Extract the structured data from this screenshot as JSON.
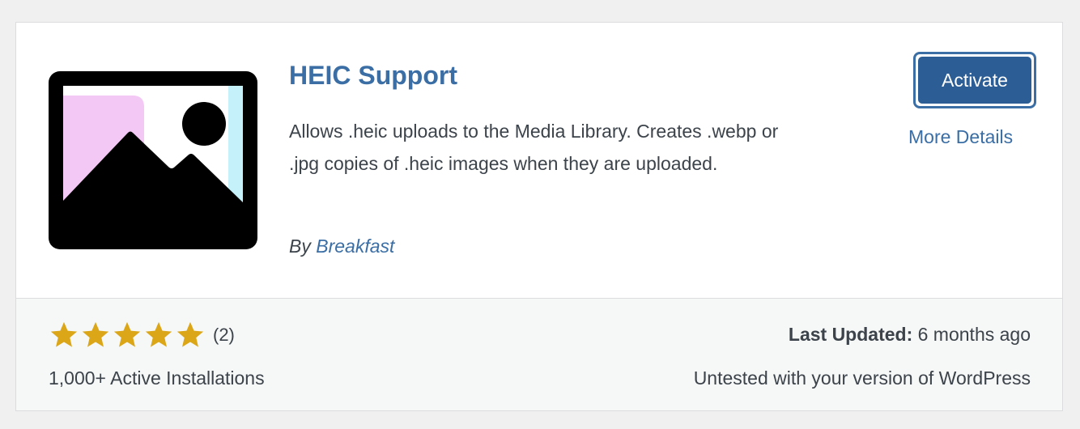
{
  "plugin": {
    "name": "HEIC Support",
    "description": "Allows .heic uploads to the Media Library. Creates .webp or .jpg copies of .heic images when they are uploaded.",
    "author_prefix": "By",
    "author": "Breakfast",
    "icon": "image-placeholder-icon"
  },
  "actions": {
    "activate_label": "Activate",
    "more_details_label": "More Details"
  },
  "footer": {
    "rating_stars": 5,
    "rating_max": 5,
    "rating_count": "(2)",
    "active_installs": "1,000+ Active Installations",
    "last_updated_label": "Last Updated:",
    "last_updated_value": "6 months ago",
    "compatibility": "Untested with your version of WordPress"
  },
  "colors": {
    "accent": "#3a6ea5",
    "button_bg": "#2c5d94",
    "star": "#dba617",
    "icon_pink": "#f4c8f5",
    "icon_cyan": "#c5f1fb"
  }
}
